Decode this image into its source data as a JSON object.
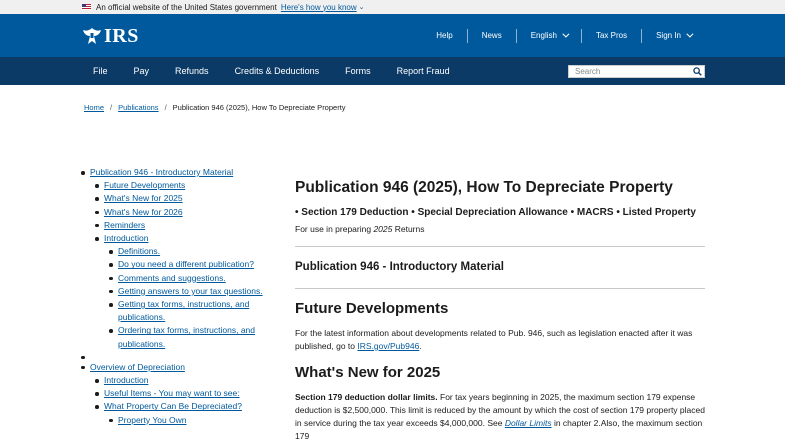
{
  "gov_banner": {
    "text": "An official website of the United States government",
    "link": "Here's how you know"
  },
  "header": {
    "logo_text": "IRS",
    "util_nav": [
      "Help",
      "News",
      "English",
      "Tax Pros",
      "Sign In"
    ]
  },
  "main_nav": {
    "items": [
      "File",
      "Pay",
      "Refunds",
      "Credits & Deductions",
      "Forms",
      "Report Fraud"
    ],
    "search_placeholder": "Search"
  },
  "breadcrumb": [
    "Home",
    "Publications",
    "Publication 946 (2025), How To Depreciate Property"
  ],
  "toc": {
    "section1": {
      "label": "Publication 946 - Introductory Material",
      "children": [
        "Future Developments",
        "What's New for 2025",
        "What's New for 2026",
        "Reminders",
        "Introduction"
      ],
      "intro_children": [
        "Definitions.",
        "Do you need a different publication?",
        "Comments and suggestions.",
        "Getting answers to your tax questions.",
        "Getting tax forms, instructions, and publications.",
        "Ordering tax forms, instructions, and publications."
      ]
    },
    "section2": {
      "label": "Overview of Depreciation",
      "children": [
        "Introduction",
        "Useful Items - You may want to see:",
        "What Property Can Be Depreciated?"
      ],
      "sub_children": [
        "Property You Own"
      ]
    }
  },
  "content": {
    "title": "Publication 946 (2025), How To Depreciate Property",
    "subtitle": "• Section 179 Deduction • Special Depreciation Allowance • MACRS • Listed Property",
    "for_use_prefix": "For use in preparing ",
    "for_use_year": "2025",
    "for_use_suffix": " Returns",
    "intro_heading": "Publication 946 - Introductory Material",
    "future_heading": "Future Developments",
    "future_text": "For the latest information about developments related to Pub. 946, such as legislation enacted after it was published, go to ",
    "future_link": "IRS.gov/Pub946",
    "future_end": ".",
    "whats_new_heading": "What's New for 2025",
    "s179_bold": "Section 179 deduction dollar limits.",
    "s179_text": " For tax years beginning in 2025, the maximum section 179 expense deduction is $2,500,000. This limit is reduced by the amount by which the cost of section 179 property placed in service during the tax year exceeds $4,000,000. See ",
    "s179_link": "Dollar Limits",
    "s179_end": " in chapter 2.Also, the maximum section 179"
  }
}
